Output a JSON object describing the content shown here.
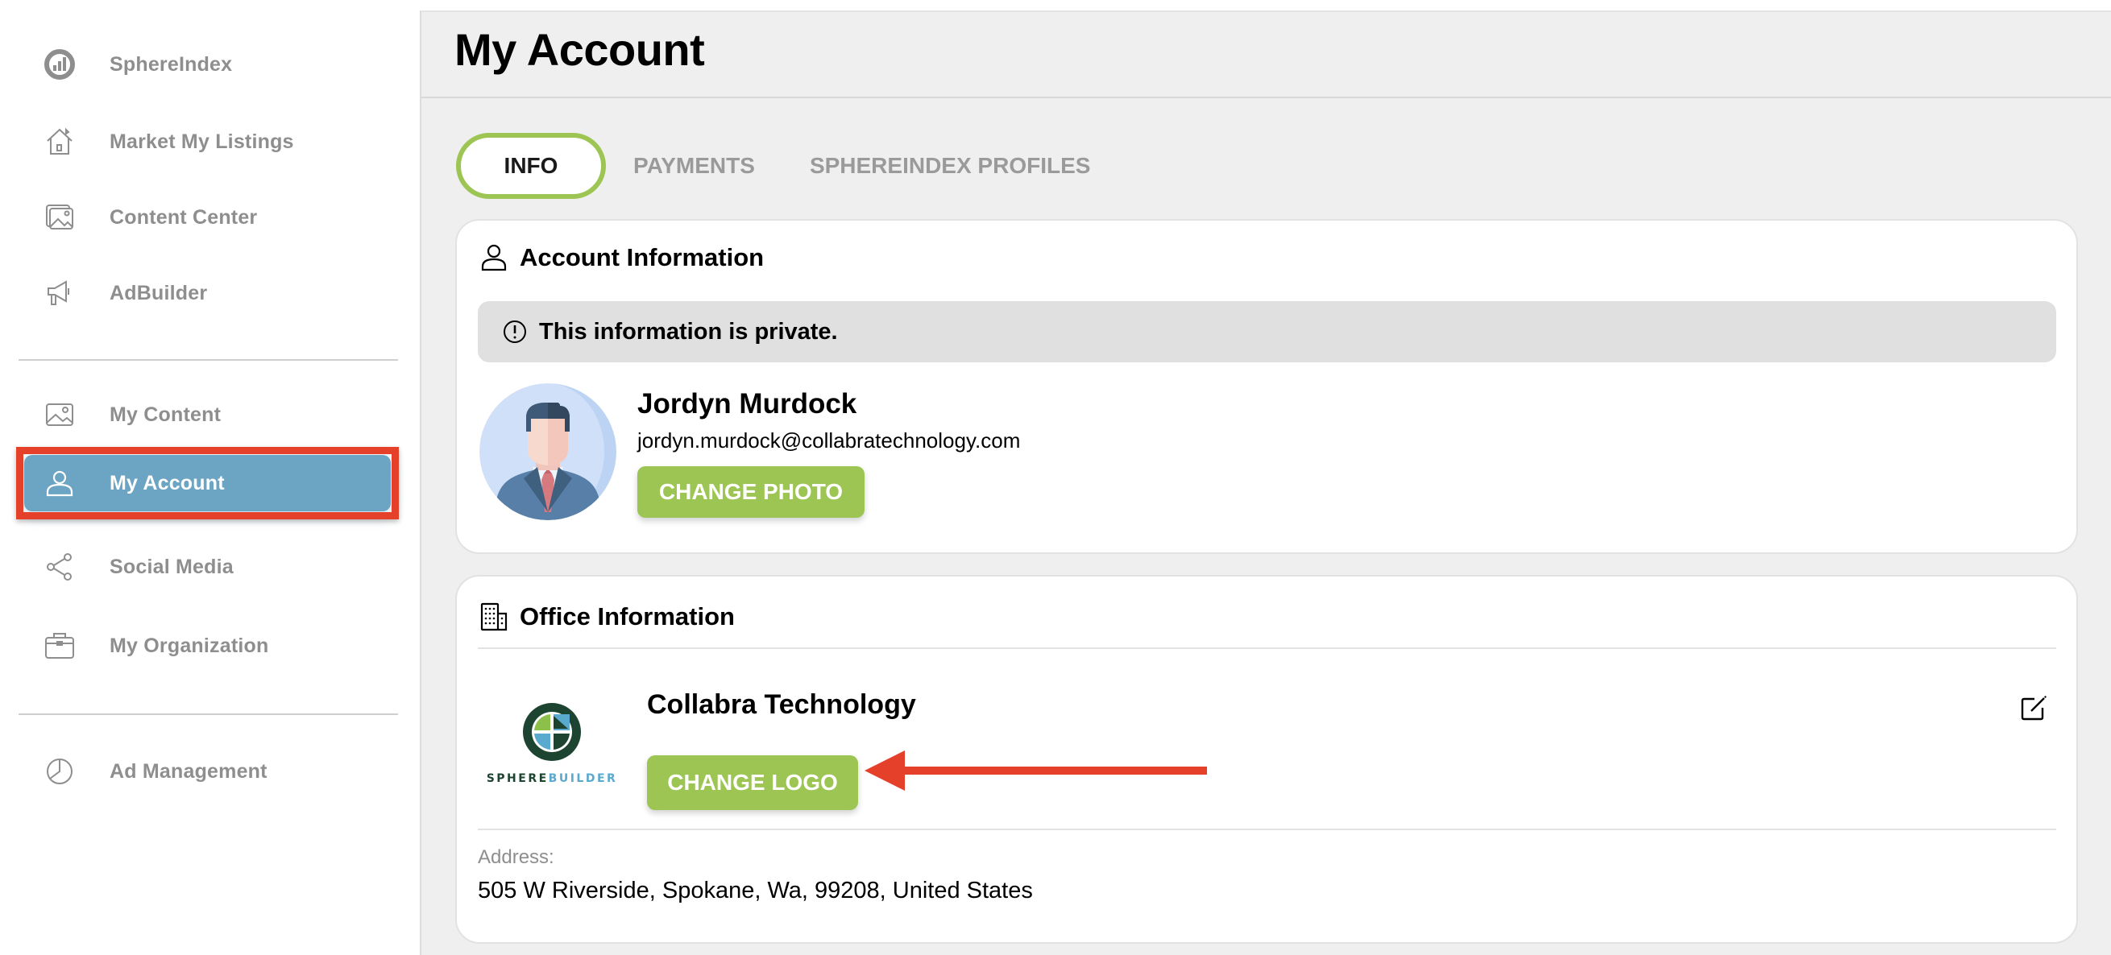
{
  "sidebar": {
    "items": [
      {
        "label": "SphereIndex",
        "icon": "sphereindex-logo-icon"
      },
      {
        "label": "Market My Listings",
        "icon": "house-icon"
      },
      {
        "label": "Content Center",
        "icon": "images-icon"
      },
      {
        "label": "AdBuilder",
        "icon": "megaphone-icon"
      },
      {
        "label": "My Content",
        "icon": "image-icon"
      },
      {
        "label": "My Account",
        "icon": "user-icon",
        "active": true
      },
      {
        "label": "Social Media",
        "icon": "share-icon"
      },
      {
        "label": "My Organization",
        "icon": "briefcase-icon"
      },
      {
        "label": "Ad Management",
        "icon": "pie-chart-icon"
      }
    ]
  },
  "header": {
    "title": "My Account"
  },
  "tabs": [
    {
      "label": "INFO",
      "active": true
    },
    {
      "label": "PAYMENTS",
      "active": false
    },
    {
      "label": "SPHEREINDEX PROFILES",
      "active": false
    }
  ],
  "account": {
    "title": "Account Information",
    "private_notice": "This information is private.",
    "name": "Jordyn Murdock",
    "email": "jordyn.murdock@collabratechnology.com",
    "change_photo_label": "CHANGE PHOTO"
  },
  "office": {
    "title": "Office Information",
    "company_name": "Collabra Technology",
    "logo_text": "SPHEREBUILDER",
    "change_logo_label": "CHANGE LOGO",
    "address_label": "Address:",
    "address": "505 W Riverside, Spokane, Wa, 99208, United States"
  },
  "colors": {
    "accent_green": "#9dc553",
    "active_nav": "#6ca4c3",
    "annotation_red": "#e5402a"
  }
}
